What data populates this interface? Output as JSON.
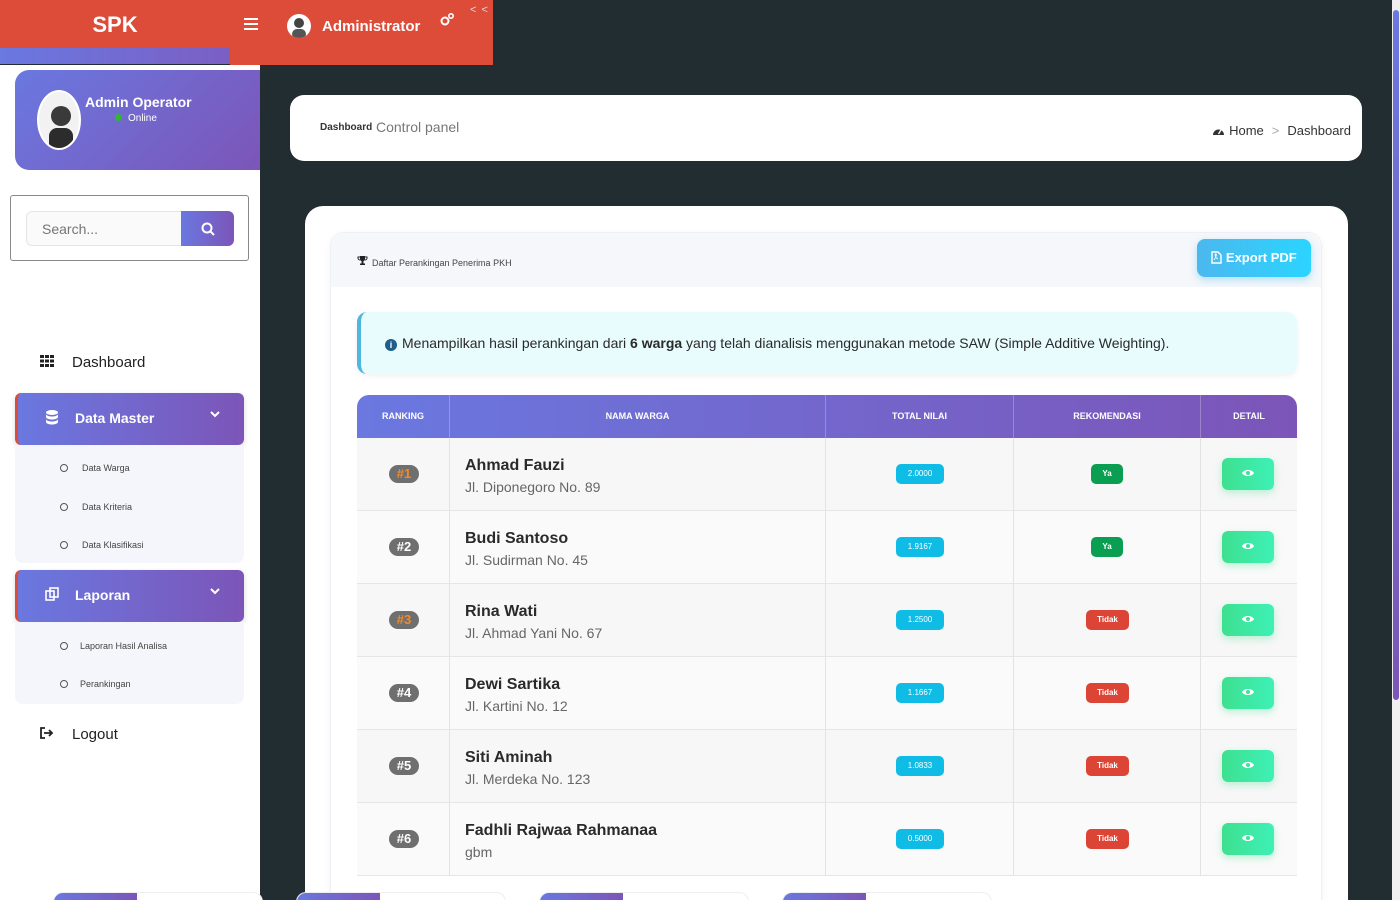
{
  "brand": "SPK",
  "topbar": {
    "user": "Administrator",
    "collapse": "< <"
  },
  "sidebar": {
    "user_name": "Admin Operator",
    "user_status": "Online",
    "search_placeholder": "Search...",
    "menu": {
      "dashboard": "Dashboard",
      "data_master": "Data Master",
      "data_master_items": [
        "Data Warga",
        "Data Kriteria",
        "Data Klasifikasi"
      ],
      "laporan": "Laporan",
      "laporan_items": [
        "Laporan Hasil Analisa",
        "Perankingan"
      ],
      "logout": "Logout"
    }
  },
  "header": {
    "title": "Dashboard",
    "subtitle": "Control panel",
    "breadcrumb": [
      "Home",
      "Dashboard"
    ]
  },
  "panel": {
    "title": "Daftar Perankingan Penerima PKH",
    "export_label": "Export PDF",
    "alert_prefix": "Menampilkan hasil perankingan dari ",
    "alert_count": "6 warga",
    "alert_suffix": " yang telah dianalisis menggunakan metode SAW (Simple Additive Weighting)."
  },
  "table": {
    "columns": [
      "RANKING",
      "NAMA WARGA",
      "TOTAL NILAI",
      "REKOMENDASI",
      "DETAIL"
    ],
    "rows": [
      {
        "rank": "#1",
        "name": "Ahmad Fauzi",
        "address": "Jl. Diponegoro No. 89",
        "score": "2.0000",
        "rec": "Ya"
      },
      {
        "rank": "#2",
        "name": "Budi Santoso",
        "address": "Jl. Sudirman No. 45",
        "score": "1.9167",
        "rec": "Ya"
      },
      {
        "rank": "#3",
        "name": "Rina Wati",
        "address": "Jl. Ahmad Yani No. 67",
        "score": "1.2500",
        "rec": "Tidak"
      },
      {
        "rank": "#4",
        "name": "Dewi Sartika",
        "address": "Jl. Kartini No. 12",
        "score": "1.1667",
        "rec": "Tidak"
      },
      {
        "rank": "#5",
        "name": "Siti Aminah",
        "address": "Jl. Merdeka No. 123",
        "score": "1.0833",
        "rec": "Tidak"
      },
      {
        "rank": "#6",
        "name": "Fadhli Rajwaa Rahmanaa",
        "address": "gbm",
        "score": "0.5000",
        "rec": "Tidak"
      }
    ]
  },
  "colors": {
    "primary_gradient_start": "#6a78e0",
    "primary_gradient_end": "#7c55b8",
    "header_red": "#dd4b39",
    "success": "#0a9e52",
    "danger": "#dc4436",
    "info": "#0fbce6"
  }
}
